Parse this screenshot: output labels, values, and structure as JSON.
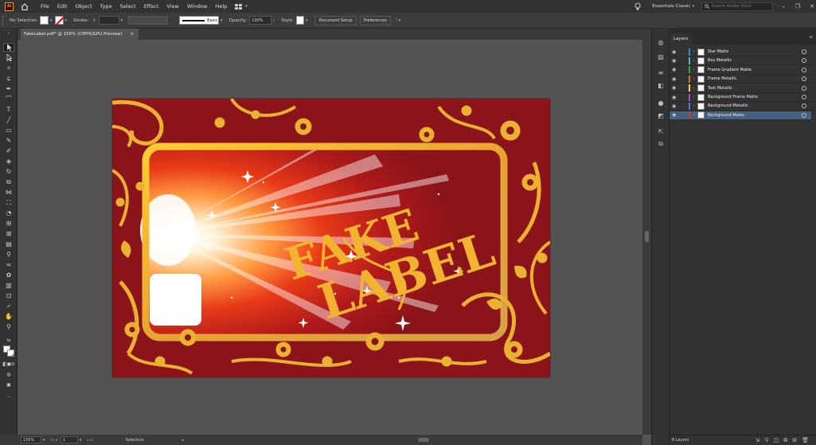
{
  "app": {
    "logo_text": "Ai"
  },
  "menu": [
    "File",
    "Edit",
    "Object",
    "Type",
    "Select",
    "Effect",
    "View",
    "Window",
    "Help"
  ],
  "workspace": {
    "label": "Essentials Classic",
    "search_placeholder": "Search Adobe Stock"
  },
  "controlbar": {
    "selection_status": "No Selection",
    "stroke_label": "Stroke:",
    "brush_label": "Basic",
    "opacity_label": "Opacity:",
    "opacity_value": "100%",
    "style_label": "Style:",
    "document_setup": "Document Setup",
    "preferences": "Preferences"
  },
  "document": {
    "tab_title": "FakeLabel.pdf* @ 150% (CMYK/GPU Preview)",
    "close_glyph": "×"
  },
  "artwork": {
    "line1": "FAKE",
    "line2": "LABEL"
  },
  "statusbar": {
    "zoom": "150%",
    "artboard": "1",
    "tool": "Selection"
  },
  "layers_panel": {
    "title": "Layers",
    "count_label": "8 Layers",
    "layers": [
      {
        "name": "Star Matte",
        "color": "#4f7fd6"
      },
      {
        "name": "Box Metallic",
        "color": "#4bbcc0"
      },
      {
        "name": "Frame Gradient Matte",
        "color": "#3aa53a"
      },
      {
        "name": "Frame Metallic",
        "color": "#e07030"
      },
      {
        "name": "Text Metallic",
        "color": "#f0d050"
      },
      {
        "name": "Background Frame Matte",
        "color": "#c040c0"
      },
      {
        "name": "Background Metallic",
        "color": "#4f7fd6"
      },
      {
        "name": "Background Matte",
        "color": "#e03030"
      }
    ],
    "selected_index": 7
  },
  "colors": {
    "accent_selected": "#46607f",
    "artboard_red": "#8a1419",
    "gold": "#f2b430"
  }
}
